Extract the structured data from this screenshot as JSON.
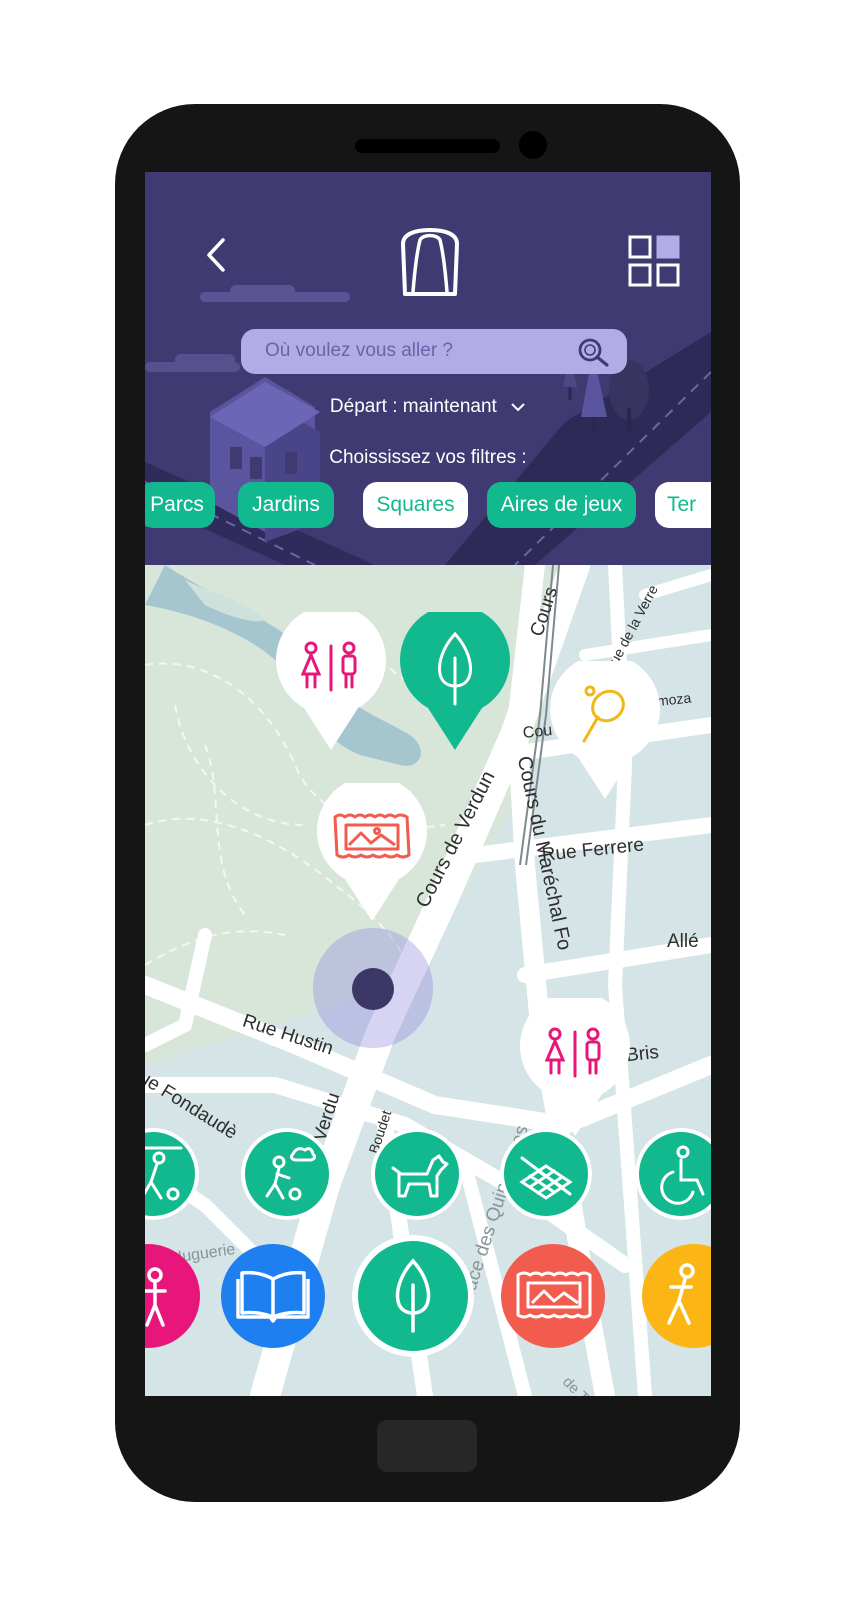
{
  "header": {
    "search": {
      "placeholder": "Où voulez vous aller ?"
    },
    "departure_label": "Départ : maintenant",
    "filters_title": "Choississez vos filtres :"
  },
  "filters": [
    {
      "label": "Parcs",
      "selected": false
    },
    {
      "label": "Jardins",
      "selected": false
    },
    {
      "label": "Squares",
      "selected": true
    },
    {
      "label": "Aires de jeux",
      "selected": false
    },
    {
      "label": "Ter",
      "selected": false
    }
  ],
  "map": {
    "streets": [
      "Cours de Verdun",
      "Cours du Maréchal Fo",
      "Rue Ferrere",
      "Rue Hustin",
      "rs de Verdu",
      "ue Fondaudè",
      "Place des Quinconces",
      "de Bris",
      "Allé",
      "Cours",
      "Cou",
      "ue de la Verre",
      "moza",
      "Huguerie",
      "Boudet",
      "de To"
    ],
    "pins": [
      {
        "icon": "toilets-icon",
        "color": "#e8157a"
      },
      {
        "icon": "tree-icon",
        "color": "#13b98e"
      },
      {
        "icon": "ping-pong-icon",
        "color": "#f2b616"
      },
      {
        "icon": "painting-icon",
        "color": "#f15c4f"
      },
      {
        "icon": "toilets-icon",
        "color": "#e8157a"
      }
    ]
  },
  "amenities": [
    "football-icon",
    "child-ball-icon",
    "dog-icon",
    "picnic-icon",
    "wheelchair-icon"
  ],
  "categories": [
    {
      "icon": "person-icon",
      "color": "#e8157a"
    },
    {
      "icon": "book-icon",
      "color": "#1d7ff0"
    },
    {
      "icon": "tree-icon",
      "color": "#13b98e",
      "selected": true
    },
    {
      "icon": "painting-icon",
      "color": "#f15c4f"
    },
    {
      "icon": "sport-icon",
      "color": "#fbb514"
    }
  ],
  "colors": {
    "header": "#3f3a72",
    "accent": "#13b98e",
    "search_bg": "#b2abe6"
  }
}
